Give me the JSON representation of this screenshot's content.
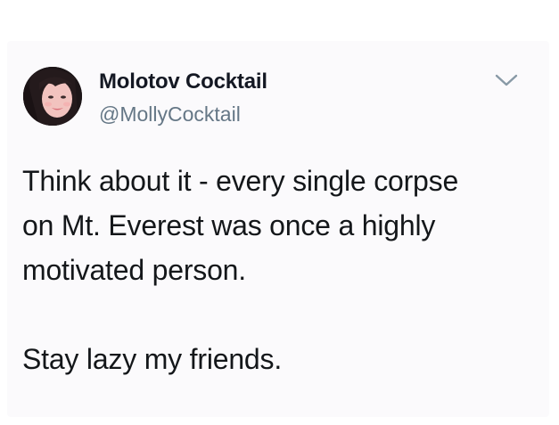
{
  "tweet": {
    "author": {
      "display_name": "Molotov Cocktail",
      "handle": "@MollyCocktail",
      "avatar_icon": "profile-photo"
    },
    "menu_icon": "chevron-down-icon",
    "body": {
      "line1": "Think about it - every single corpse\non Mt. Everest was once a highly\nmotivated person.",
      "line2": "Stay lazy my friends."
    }
  },
  "colors": {
    "name": "#141823",
    "handle": "#657786",
    "text": "#14171a",
    "chevron": "#8899a6",
    "background": "#ffffff"
  }
}
